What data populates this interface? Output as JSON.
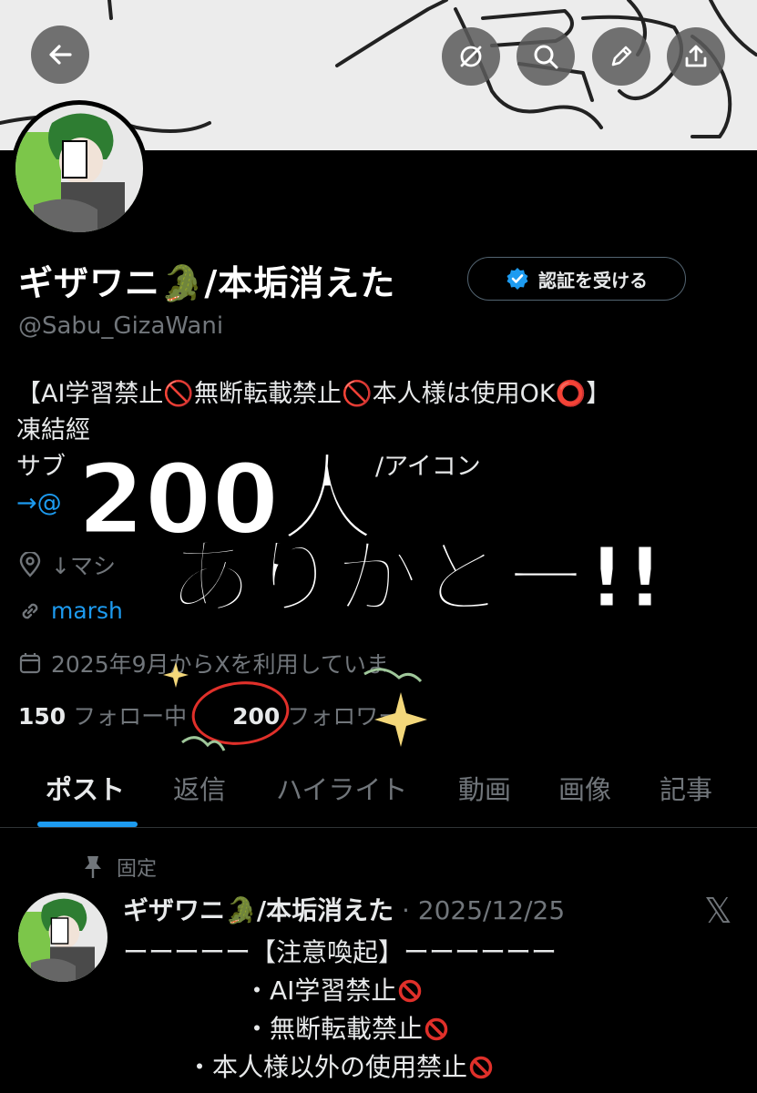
{
  "profile": {
    "display_name": "ギザワニ🐊/本垢消えた",
    "verify_label": "認証を受ける",
    "handle": "@Sabu_GizaWani",
    "bio_line1": "【AI学習禁止🚫無断転載禁止🚫本人様は使用OK⭕】",
    "bio_line2": "凍結經",
    "bio_line3a": "サブ",
    "bio_line3b": "/アイコン",
    "bio_line4": "→@",
    "location": "↓マシ",
    "link": "marsh",
    "joined": "2025年9月からXを利用していま"
  },
  "stats": {
    "following_count": "150",
    "following_label": "フォロー中",
    "followers_count": "200",
    "followers_label": "フォロワー"
  },
  "tabs": [
    "ポスト",
    "返信",
    "ハイライト",
    "動画",
    "画像",
    "記事"
  ],
  "pinned_post": {
    "pinned_label": "固定",
    "author": "ギザワニ🐊/本垢消えた",
    "date": "· 2025/12/25",
    "line1": "ーーーーー【注意喚起】ーーーーーー",
    "line2": "・AI学習禁止",
    "line3": "・無断転載禁止",
    "line4": "・本人様以外の使用禁止"
  },
  "handwriting": {
    "line1": "200人",
    "line2": "ありがとー!!"
  },
  "colors": {
    "accent": "#1d9bf0",
    "background": "#000000",
    "secondary_text": "#71767b",
    "circle_mark": "#e0302a",
    "sparkle": "#f3d77a"
  },
  "icons": [
    "back-icon",
    "grok-icon",
    "search-icon",
    "edit-icon",
    "share-icon",
    "verified-badge-icon",
    "location-icon",
    "link-icon",
    "calendar-icon",
    "pin-icon",
    "x-logo-icon",
    "prohibited-icon"
  ]
}
